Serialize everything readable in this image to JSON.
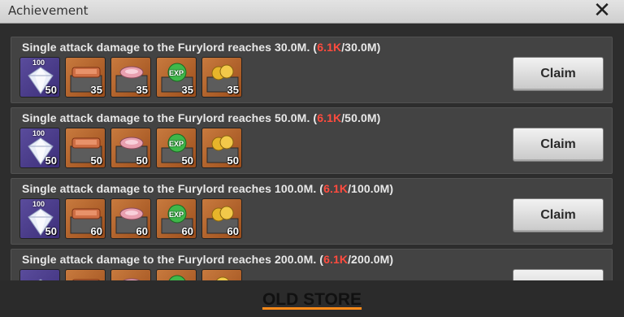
{
  "window": {
    "title": "Achievement",
    "close_icon": "close-icon"
  },
  "colors": {
    "current_progress": "#ff4b3e",
    "footer_underline": "#ff8a1a"
  },
  "achievements": [
    {
      "prefix": "Single attack damage to the Furylord reaches 30.0M.  (",
      "current": "6.1K",
      "suffix": "/30.0M)",
      "claim_label": "Claim",
      "rewards": [
        {
          "kind": "diamond",
          "tag": "100",
          "qty": "50"
        },
        {
          "kind": "chest-copper",
          "qty": "35"
        },
        {
          "kind": "chest-pink",
          "qty": "35"
        },
        {
          "kind": "chest-exp",
          "tag": "EXP",
          "qty": "35"
        },
        {
          "kind": "chest-gold",
          "qty": "35"
        }
      ]
    },
    {
      "prefix": "Single attack damage to the Furylord reaches 50.0M.  (",
      "current": "6.1K",
      "suffix": "/50.0M)",
      "claim_label": "Claim",
      "rewards": [
        {
          "kind": "diamond",
          "tag": "100",
          "qty": "50"
        },
        {
          "kind": "chest-copper",
          "qty": "50"
        },
        {
          "kind": "chest-pink",
          "qty": "50"
        },
        {
          "kind": "chest-exp",
          "tag": "EXP",
          "qty": "50"
        },
        {
          "kind": "chest-gold",
          "qty": "50"
        }
      ]
    },
    {
      "prefix": "Single attack damage to the Furylord reaches 100.0M.  (",
      "current": "6.1K",
      "suffix": "/100.0M)",
      "claim_label": "Claim",
      "rewards": [
        {
          "kind": "diamond",
          "tag": "100",
          "qty": "50"
        },
        {
          "kind": "chest-copper",
          "qty": "60"
        },
        {
          "kind": "chest-pink",
          "qty": "60"
        },
        {
          "kind": "chest-exp",
          "tag": "EXP",
          "qty": "60"
        },
        {
          "kind": "chest-gold",
          "qty": "60"
        }
      ]
    },
    {
      "prefix": "Single attack damage to the Furylord reaches 200.0M.  (",
      "current": "6.1K",
      "suffix": "/200.0M)",
      "claim_label": "",
      "rewards": [
        {
          "kind": "diamond",
          "tag": "",
          "qty": ""
        },
        {
          "kind": "chest-copper",
          "qty": ""
        },
        {
          "kind": "chest-pink",
          "qty": ""
        },
        {
          "kind": "chest-exp",
          "tag": "",
          "qty": ""
        },
        {
          "kind": "chest-gold",
          "qty": ""
        }
      ]
    }
  ],
  "footer": {
    "link_label": "OLD STORE"
  }
}
